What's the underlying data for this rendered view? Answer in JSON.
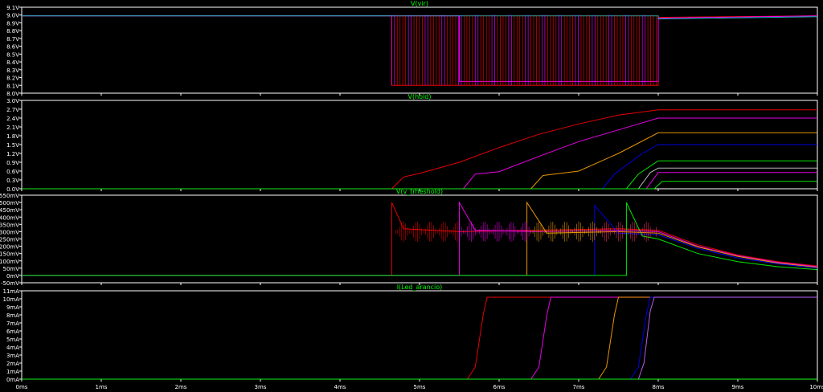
{
  "x_axis": {
    "ticks": [
      {
        "v": 0,
        "label": "0ms"
      },
      {
        "v": 1,
        "label": "1ms"
      },
      {
        "v": 2,
        "label": "2ms"
      },
      {
        "v": 3,
        "label": "3ms"
      },
      {
        "v": 4,
        "label": "4ms"
      },
      {
        "v": 5,
        "label": "5ms"
      },
      {
        "v": 6,
        "label": "6ms"
      },
      {
        "v": 7,
        "label": "7ms"
      },
      {
        "v": 8,
        "label": "8ms"
      },
      {
        "v": 9,
        "label": "9ms"
      },
      {
        "v": 10,
        "label": "10ms"
      }
    ]
  },
  "colors": {
    "background": "#000000",
    "frame": "#ffffff",
    "title": "#00ff00",
    "grid": "#404040",
    "traces": [
      "#ff0000",
      "#ff00ff",
      "#ffa500",
      "#0000ff",
      "#00ff00",
      "#00cccc",
      "#ff3366",
      "#cc66ff"
    ]
  },
  "chart_data": [
    {
      "type": "line",
      "title": "V(vir)",
      "xlim": [
        0,
        10
      ],
      "ylim": [
        8.0,
        9.1
      ],
      "yticks": [
        {
          "v": 9.1,
          "label": "9.1V"
        },
        {
          "v": 9.0,
          "label": "9.0V"
        },
        {
          "v": 8.9,
          "label": "8.9V"
        },
        {
          "v": 8.8,
          "label": "8.8V"
        },
        {
          "v": 8.7,
          "label": "8.7V"
        },
        {
          "v": 8.6,
          "label": "8.6V"
        },
        {
          "v": 8.5,
          "label": "8.5V"
        },
        {
          "v": 8.4,
          "label": "8.4V"
        },
        {
          "v": 8.3,
          "label": "8.3V"
        },
        {
          "v": 8.2,
          "label": "8.2V"
        },
        {
          "v": 8.1,
          "label": "8.1V"
        },
        {
          "v": 8.0,
          "label": "8.0V"
        }
      ],
      "series": [
        {
          "color": "#ff0000",
          "x": [
            0,
            4.65,
            4.65,
            8.0,
            8.0,
            10
          ],
          "y": [
            8.99,
            8.99,
            8.1,
            8.1,
            8.97,
            8.99
          ]
        },
        {
          "color": "#ff00ff",
          "x": [
            0,
            5.5,
            5.5,
            8.0,
            8.0,
            10
          ],
          "y": [
            8.99,
            8.99,
            8.15,
            8.15,
            8.96,
            8.99
          ]
        },
        {
          "color": "#00cccc",
          "x": [
            0,
            8.0,
            8.0,
            10
          ],
          "y": [
            8.99,
            8.99,
            8.95,
            8.98
          ]
        }
      ]
    },
    {
      "type": "line",
      "title": "V(hold)",
      "xlim": [
        0,
        10
      ],
      "ylim": [
        0.0,
        3.0
      ],
      "yticks": [
        {
          "v": 3.0,
          "label": "3.0V"
        },
        {
          "v": 2.7,
          "label": "2.7V"
        },
        {
          "v": 2.4,
          "label": "2.4V"
        },
        {
          "v": 2.1,
          "label": "2.1V"
        },
        {
          "v": 1.8,
          "label": "1.8V"
        },
        {
          "v": 1.5,
          "label": "1.5V"
        },
        {
          "v": 1.2,
          "label": "1.2V"
        },
        {
          "v": 0.9,
          "label": "0.9V"
        },
        {
          "v": 0.6,
          "label": "0.6V"
        },
        {
          "v": 0.3,
          "label": "0.3V"
        },
        {
          "v": 0.0,
          "label": "0.0V"
        }
      ],
      "series": [
        {
          "color": "#ff0000",
          "x": [
            0,
            4.65,
            4.8,
            5.0,
            5.5,
            6.0,
            6.5,
            7.0,
            7.5,
            8.0,
            10
          ],
          "y": [
            0,
            0,
            0.4,
            0.52,
            0.9,
            1.4,
            1.85,
            2.2,
            2.5,
            2.68,
            2.68
          ]
        },
        {
          "color": "#ff00ff",
          "x": [
            0,
            5.55,
            5.7,
            6.0,
            6.5,
            7.0,
            7.5,
            8.0,
            10
          ],
          "y": [
            0,
            0,
            0.5,
            0.58,
            1.1,
            1.6,
            2.0,
            2.4,
            2.4
          ]
        },
        {
          "color": "#ffa500",
          "x": [
            0,
            6.4,
            6.55,
            7.0,
            7.5,
            8.0,
            10
          ],
          "y": [
            0,
            0,
            0.45,
            0.6,
            1.2,
            1.9,
            1.9
          ]
        },
        {
          "color": "#0000ff",
          "x": [
            0,
            7.3,
            7.45,
            7.8,
            8.0,
            10
          ],
          "y": [
            0,
            0,
            0.5,
            1.2,
            1.5,
            1.5
          ]
        },
        {
          "color": "#00ff00",
          "x": [
            0,
            7.6,
            7.75,
            8.0,
            10
          ],
          "y": [
            0,
            0,
            0.5,
            0.95,
            0.95
          ]
        },
        {
          "color": "#cccccc",
          "x": [
            0,
            7.75,
            7.9,
            8.0,
            10
          ],
          "y": [
            0,
            0,
            0.55,
            0.7,
            0.7
          ]
        },
        {
          "color": "#ff00ff",
          "x": [
            0,
            7.85,
            8.0,
            10
          ],
          "y": [
            0,
            0,
            0.55,
            0.55
          ]
        },
        {
          "color": "#00ff00",
          "x": [
            0,
            7.95,
            8.05,
            10
          ],
          "y": [
            0,
            0,
            0.25,
            0.25
          ]
        }
      ]
    },
    {
      "type": "line",
      "title": "V(v_trheshold)",
      "xlim": [
        0,
        10
      ],
      "ylim": [
        -50,
        550
      ],
      "yticks": [
        {
          "v": 550,
          "label": "550mV"
        },
        {
          "v": 500,
          "label": "500mV"
        },
        {
          "v": 450,
          "label": "450mV"
        },
        {
          "v": 400,
          "label": "400mV"
        },
        {
          "v": 350,
          "label": "350mV"
        },
        {
          "v": 300,
          "label": "300mV"
        },
        {
          "v": 250,
          "label": "250mV"
        },
        {
          "v": 200,
          "label": "200mV"
        },
        {
          "v": 150,
          "label": "150mV"
        },
        {
          "v": 100,
          "label": "100mV"
        },
        {
          "v": 50,
          "label": "50mV"
        },
        {
          "v": 0,
          "label": "0mV"
        },
        {
          "v": -50,
          "label": "-50mV"
        }
      ],
      "series": [
        {
          "color": "#ff0000",
          "x": [
            0,
            4.65,
            4.65,
            4.8,
            5.5,
            6.5,
            7.5,
            8.0,
            8.5,
            9.0,
            9.5,
            10
          ],
          "y": [
            0,
            0,
            500,
            320,
            300,
            310,
            320,
            310,
            210,
            140,
            95,
            65
          ]
        },
        {
          "color": "#ff00ff",
          "x": [
            0,
            5.5,
            5.5,
            5.7,
            6.5,
            7.5,
            8.0,
            8.5,
            9.0,
            9.5,
            10
          ],
          "y": [
            0,
            0,
            500,
            310,
            300,
            310,
            300,
            200,
            135,
            90,
            60
          ]
        },
        {
          "color": "#ffa500",
          "x": [
            0,
            6.35,
            6.35,
            6.6,
            7.5,
            8.0,
            8.5,
            9.0,
            9.5,
            10
          ],
          "y": [
            0,
            0,
            500,
            290,
            300,
            290,
            195,
            130,
            85,
            55
          ]
        },
        {
          "color": "#0000ff",
          "x": [
            0,
            7.2,
            7.2,
            7.5,
            8.0,
            8.5,
            9.0,
            9.5,
            10
          ],
          "y": [
            0,
            0,
            480,
            290,
            280,
            185,
            120,
            80,
            50
          ]
        },
        {
          "color": "#00ff00",
          "x": [
            0,
            7.6,
            7.6,
            7.8,
            8.0,
            8.5,
            9.0,
            9.5,
            10
          ],
          "y": [
            0,
            0,
            500,
            270,
            250,
            150,
            95,
            60,
            40
          ]
        }
      ]
    },
    {
      "type": "line",
      "title": "I(Led_arancio)",
      "xlim": [
        0,
        10
      ],
      "ylim": [
        0,
        11
      ],
      "yticks": [
        {
          "v": 11,
          "label": "11mA"
        },
        {
          "v": 10,
          "label": "10mA"
        },
        {
          "v": 9,
          "label": "9mA"
        },
        {
          "v": 8,
          "label": "8mA"
        },
        {
          "v": 7,
          "label": "7mA"
        },
        {
          "v": 6,
          "label": "6mA"
        },
        {
          "v": 5,
          "label": "5mA"
        },
        {
          "v": 4,
          "label": "4mA"
        },
        {
          "v": 3,
          "label": "3mA"
        },
        {
          "v": 2,
          "label": "2mA"
        },
        {
          "v": 1,
          "label": "1mA"
        },
        {
          "v": 0,
          "label": "0mA"
        }
      ],
      "series": [
        {
          "color": "#ff0000",
          "x": [
            0,
            5.6,
            5.7,
            5.8,
            5.85,
            10
          ],
          "y": [
            0,
            0,
            1.5,
            8,
            10.2,
            10.2
          ]
        },
        {
          "color": "#ff00ff",
          "x": [
            0,
            6.4,
            6.5,
            6.6,
            6.65,
            10
          ],
          "y": [
            0,
            0,
            1.5,
            8,
            10.2,
            10.2
          ]
        },
        {
          "color": "#ffa500",
          "x": [
            0,
            7.25,
            7.35,
            7.45,
            7.5,
            10
          ],
          "y": [
            0,
            0,
            1.5,
            8,
            10.2,
            10.2
          ]
        },
        {
          "color": "#0000ff",
          "x": [
            0,
            7.65,
            7.75,
            7.85,
            7.9,
            10
          ],
          "y": [
            0,
            0,
            1.5,
            8,
            10.2,
            10.2
          ]
        },
        {
          "color": "#cc66ff",
          "x": [
            0,
            7.75,
            7.82,
            7.9,
            7.95,
            10
          ],
          "y": [
            0,
            0,
            2,
            8.5,
            10.2,
            10.2
          ]
        },
        {
          "color": "#00ff00",
          "x": [
            0,
            10
          ],
          "y": [
            0,
            0
          ]
        }
      ]
    }
  ]
}
